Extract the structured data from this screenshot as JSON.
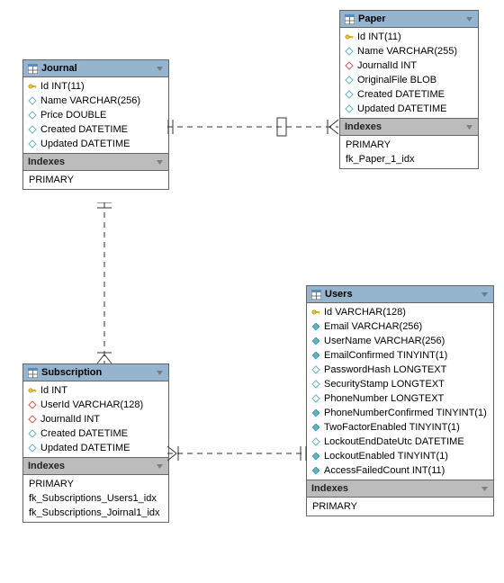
{
  "entities": {
    "journal": {
      "title": "Journal",
      "columns": [
        {
          "icon": "key",
          "text": "Id INT(11)"
        },
        {
          "icon": "diamond",
          "text": "Name VARCHAR(256)"
        },
        {
          "icon": "diamond",
          "text": "Price DOUBLE"
        },
        {
          "icon": "diamond",
          "text": "Created DATETIME"
        },
        {
          "icon": "diamond",
          "text": "Updated DATETIME"
        }
      ],
      "indexes_label": "Indexes",
      "indexes": [
        "PRIMARY"
      ]
    },
    "paper": {
      "title": "Paper",
      "columns": [
        {
          "icon": "key",
          "text": "Id INT(11)"
        },
        {
          "icon": "diamond",
          "text": "Name VARCHAR(255)"
        },
        {
          "icon": "fk",
          "text": "JournalId INT"
        },
        {
          "icon": "diamond",
          "text": "OriginalFile BLOB"
        },
        {
          "icon": "diamond",
          "text": "Created DATETIME"
        },
        {
          "icon": "diamond",
          "text": "Updated DATETIME"
        }
      ],
      "indexes_label": "Indexes",
      "indexes": [
        "PRIMARY",
        "fk_Paper_1_idx"
      ]
    },
    "subscription": {
      "title": "Subscription",
      "columns": [
        {
          "icon": "key",
          "text": "Id INT"
        },
        {
          "icon": "fk",
          "text": "UserId VARCHAR(128)"
        },
        {
          "icon": "fk",
          "text": "JournalId INT"
        },
        {
          "icon": "diamond",
          "text": "Created DATETIME"
        },
        {
          "icon": "diamond",
          "text": "Updated DATETIME"
        }
      ],
      "indexes_label": "Indexes",
      "indexes": [
        "PRIMARY",
        "fk_Subscriptions_Users1_idx",
        "fk_Subscriptions_Joirnal1_idx"
      ]
    },
    "users": {
      "title": "Users",
      "columns": [
        {
          "icon": "key",
          "text": "Id VARCHAR(128)"
        },
        {
          "icon": "diamond-solid",
          "text": "Email VARCHAR(256)"
        },
        {
          "icon": "diamond-solid",
          "text": "UserName VARCHAR(256)"
        },
        {
          "icon": "diamond-solid",
          "text": "EmailConfirmed TINYINT(1)"
        },
        {
          "icon": "diamond",
          "text": "PasswordHash LONGTEXT"
        },
        {
          "icon": "diamond",
          "text": "SecurityStamp LONGTEXT"
        },
        {
          "icon": "diamond",
          "text": "PhoneNumber LONGTEXT"
        },
        {
          "icon": "diamond-solid",
          "text": "PhoneNumberConfirmed TINYINT(1)"
        },
        {
          "icon": "diamond-solid",
          "text": "TwoFactorEnabled TINYINT(1)"
        },
        {
          "icon": "diamond",
          "text": "LockoutEndDateUtc DATETIME"
        },
        {
          "icon": "diamond-solid",
          "text": "LockoutEnabled TINYINT(1)"
        },
        {
          "icon": "diamond-solid",
          "text": "AccessFailedCount INT(11)"
        }
      ],
      "indexes_label": "Indexes",
      "indexes": [
        "PRIMARY"
      ]
    }
  }
}
